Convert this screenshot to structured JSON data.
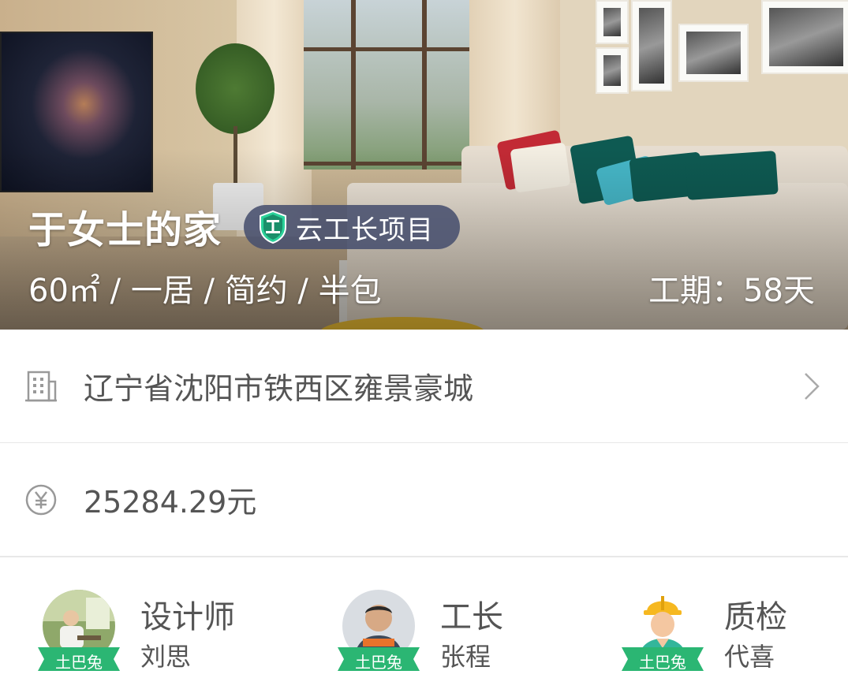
{
  "header": {
    "title": "于女士的家",
    "badge_label": "云工长项目",
    "area": "60㎡",
    "attributes": "/ 一居 / 简约 / 半包",
    "duration": "工期：58天"
  },
  "address": {
    "text": "辽宁省沈阳市铁西区雍景豪城",
    "icon": "building-icon"
  },
  "price": {
    "text": "25284.29元",
    "icon": "yuan-icon"
  },
  "team": [
    {
      "role": "设计师",
      "name": "刘思",
      "tag": "土巴兔"
    },
    {
      "role": "工长",
      "name": "张程",
      "tag": "土巴兔"
    },
    {
      "role": "质检",
      "name": "代喜",
      "tag": "土巴兔"
    }
  ],
  "colors": {
    "accent_green": "#2bb673",
    "badge_bg": "#48506e",
    "text_gray": "#555555"
  }
}
